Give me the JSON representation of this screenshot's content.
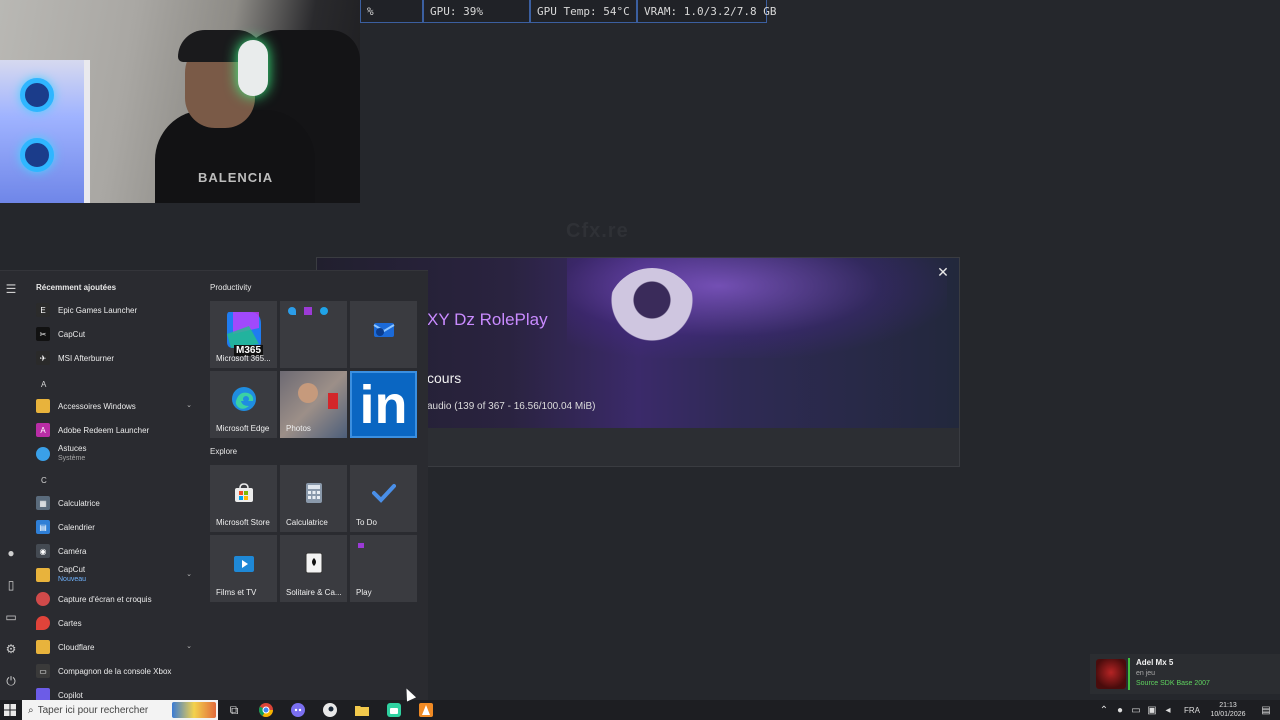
{
  "overlay": {
    "stats": [
      "%",
      "GPU: 39%",
      "GPU Temp: 54°C",
      "VRAM: 1.0/3.2/7.8 GB"
    ]
  },
  "webcam": {
    "shirt_text": "BALENCIA"
  },
  "background": {
    "watermark": "Cfx.re"
  },
  "loader": {
    "server_name": "XY Dz RolePlay",
    "status": "cours",
    "detail": "audio (139 of 367 - 16.56/100.04 MiB)",
    "close_icon": "close-icon"
  },
  "start_menu": {
    "recent_title": "Récemment ajoutées",
    "apps": [
      {
        "label": "Epic Games Launcher",
        "icon": "epic-games-icon",
        "color": "#2b2b2b"
      },
      {
        "label": "CapCut",
        "icon": "capcut-icon",
        "color": "#111111"
      },
      {
        "label": "MSI Afterburner",
        "icon": "msi-afterburner-icon",
        "color": "#2a2a2a"
      },
      {
        "label": "Accessoires Windows",
        "icon": "folder-icon",
        "color": "#e8b33c"
      },
      {
        "label": "Adobe Redeem Launcher",
        "icon": "adobe-icon",
        "color": "#b92da6"
      },
      {
        "label": "Astuces",
        "sub": "Système",
        "icon": "lightbulb-icon",
        "color": "#3aa0e8"
      },
      {
        "label": "Calculatrice",
        "icon": "calculator-icon",
        "color": "#5a6b7c"
      },
      {
        "label": "Calendrier",
        "icon": "calendar-icon",
        "color": "#2f7fd6"
      },
      {
        "label": "Caméra",
        "icon": "camera-icon",
        "color": "#444a52"
      },
      {
        "label": "CapCut",
        "sub": "Nouveau",
        "icon": "folder-icon",
        "color": "#e8b33c"
      },
      {
        "label": "Capture d'écran et croquis",
        "icon": "snipping-tool-icon",
        "color": "#d04a4a"
      },
      {
        "label": "Cartes",
        "icon": "maps-pin-icon",
        "color": "#e0433a"
      },
      {
        "label": "Cloudflare",
        "icon": "folder-icon",
        "color": "#e8b33c"
      },
      {
        "label": "Compagnon de la console Xbox",
        "icon": "xbox-icon",
        "color": "#3a3a3a"
      },
      {
        "label": "Copilot",
        "icon": "copilot-icon",
        "color": "#6c5ce7"
      }
    ],
    "letters": [
      "A",
      "C"
    ],
    "groups": [
      "Productivity",
      "Explore"
    ],
    "tiles": [
      {
        "label": "Microsoft 365...",
        "badge": "M365",
        "icon": "microsoft-365-icon"
      },
      {
        "label": "",
        "icon": "office-apps-icon"
      },
      {
        "label": "",
        "icon": "outlook-icon"
      },
      {
        "label": "Microsoft Edge",
        "icon": "edge-icon"
      },
      {
        "label": "Photos",
        "icon": "photos-icon"
      },
      {
        "label": "in",
        "icon": "linkedin-icon"
      },
      {
        "label": "Microsoft Store",
        "icon": "store-icon"
      },
      {
        "label": "Calculatrice",
        "icon": "calculator-icon"
      },
      {
        "label": "To Do",
        "icon": "todo-check-icon"
      },
      {
        "label": "Films et TV",
        "icon": "films-tv-icon"
      },
      {
        "label": "Solitaire & Ca...",
        "icon": "solitaire-icon"
      },
      {
        "label": "Play",
        "icon": "play-icon"
      }
    ]
  },
  "notification": {
    "name": "Adel Mx 5",
    "status": "en jeu",
    "game": "Source SDK Base 2007"
  },
  "taskbar": {
    "search_placeholder": "Taper ici pour rechercher",
    "lang": "FRA",
    "time": "21:13",
    "date": "10/01/2026"
  }
}
